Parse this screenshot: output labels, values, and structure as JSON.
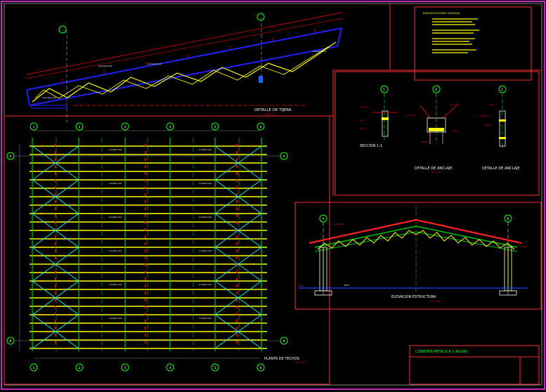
{
  "drawing": {
    "truss_detail_title": "DETALLE DE TIJERA",
    "section_title": "SECCION 1-1",
    "anchor_title_1": "DETALLE DE ANCLAJE",
    "anchor_title_2": "DETALLE DE ANCLAJE",
    "plan_title": "PLANTA DE TECHOS",
    "elevation_title": "ELEVACION ESTRUCTURA",
    "title_block_name": "CUBIERTA METALICA 2 AGUAS",
    "grid_numbers": [
      "1",
      "2",
      "3",
      "4",
      "5",
      "6"
    ],
    "grid_letters": [
      "A",
      "B"
    ],
    "detail_bubble_labels": [
      "1",
      "A",
      "1",
      "B"
    ],
    "notes_heading": "ESPECIFICACIONES TECNICAS",
    "colors": {
      "background": "#000000",
      "frame": "#ff3cff",
      "panel_border": "#ff2d2d",
      "purlin": "#ffff00",
      "member": "#00c800",
      "chord": "#0000ff",
      "bracing": "#00ffff",
      "label": "#ffffff",
      "annotation": "#ff0000",
      "title_text": "#00ff00"
    }
  }
}
